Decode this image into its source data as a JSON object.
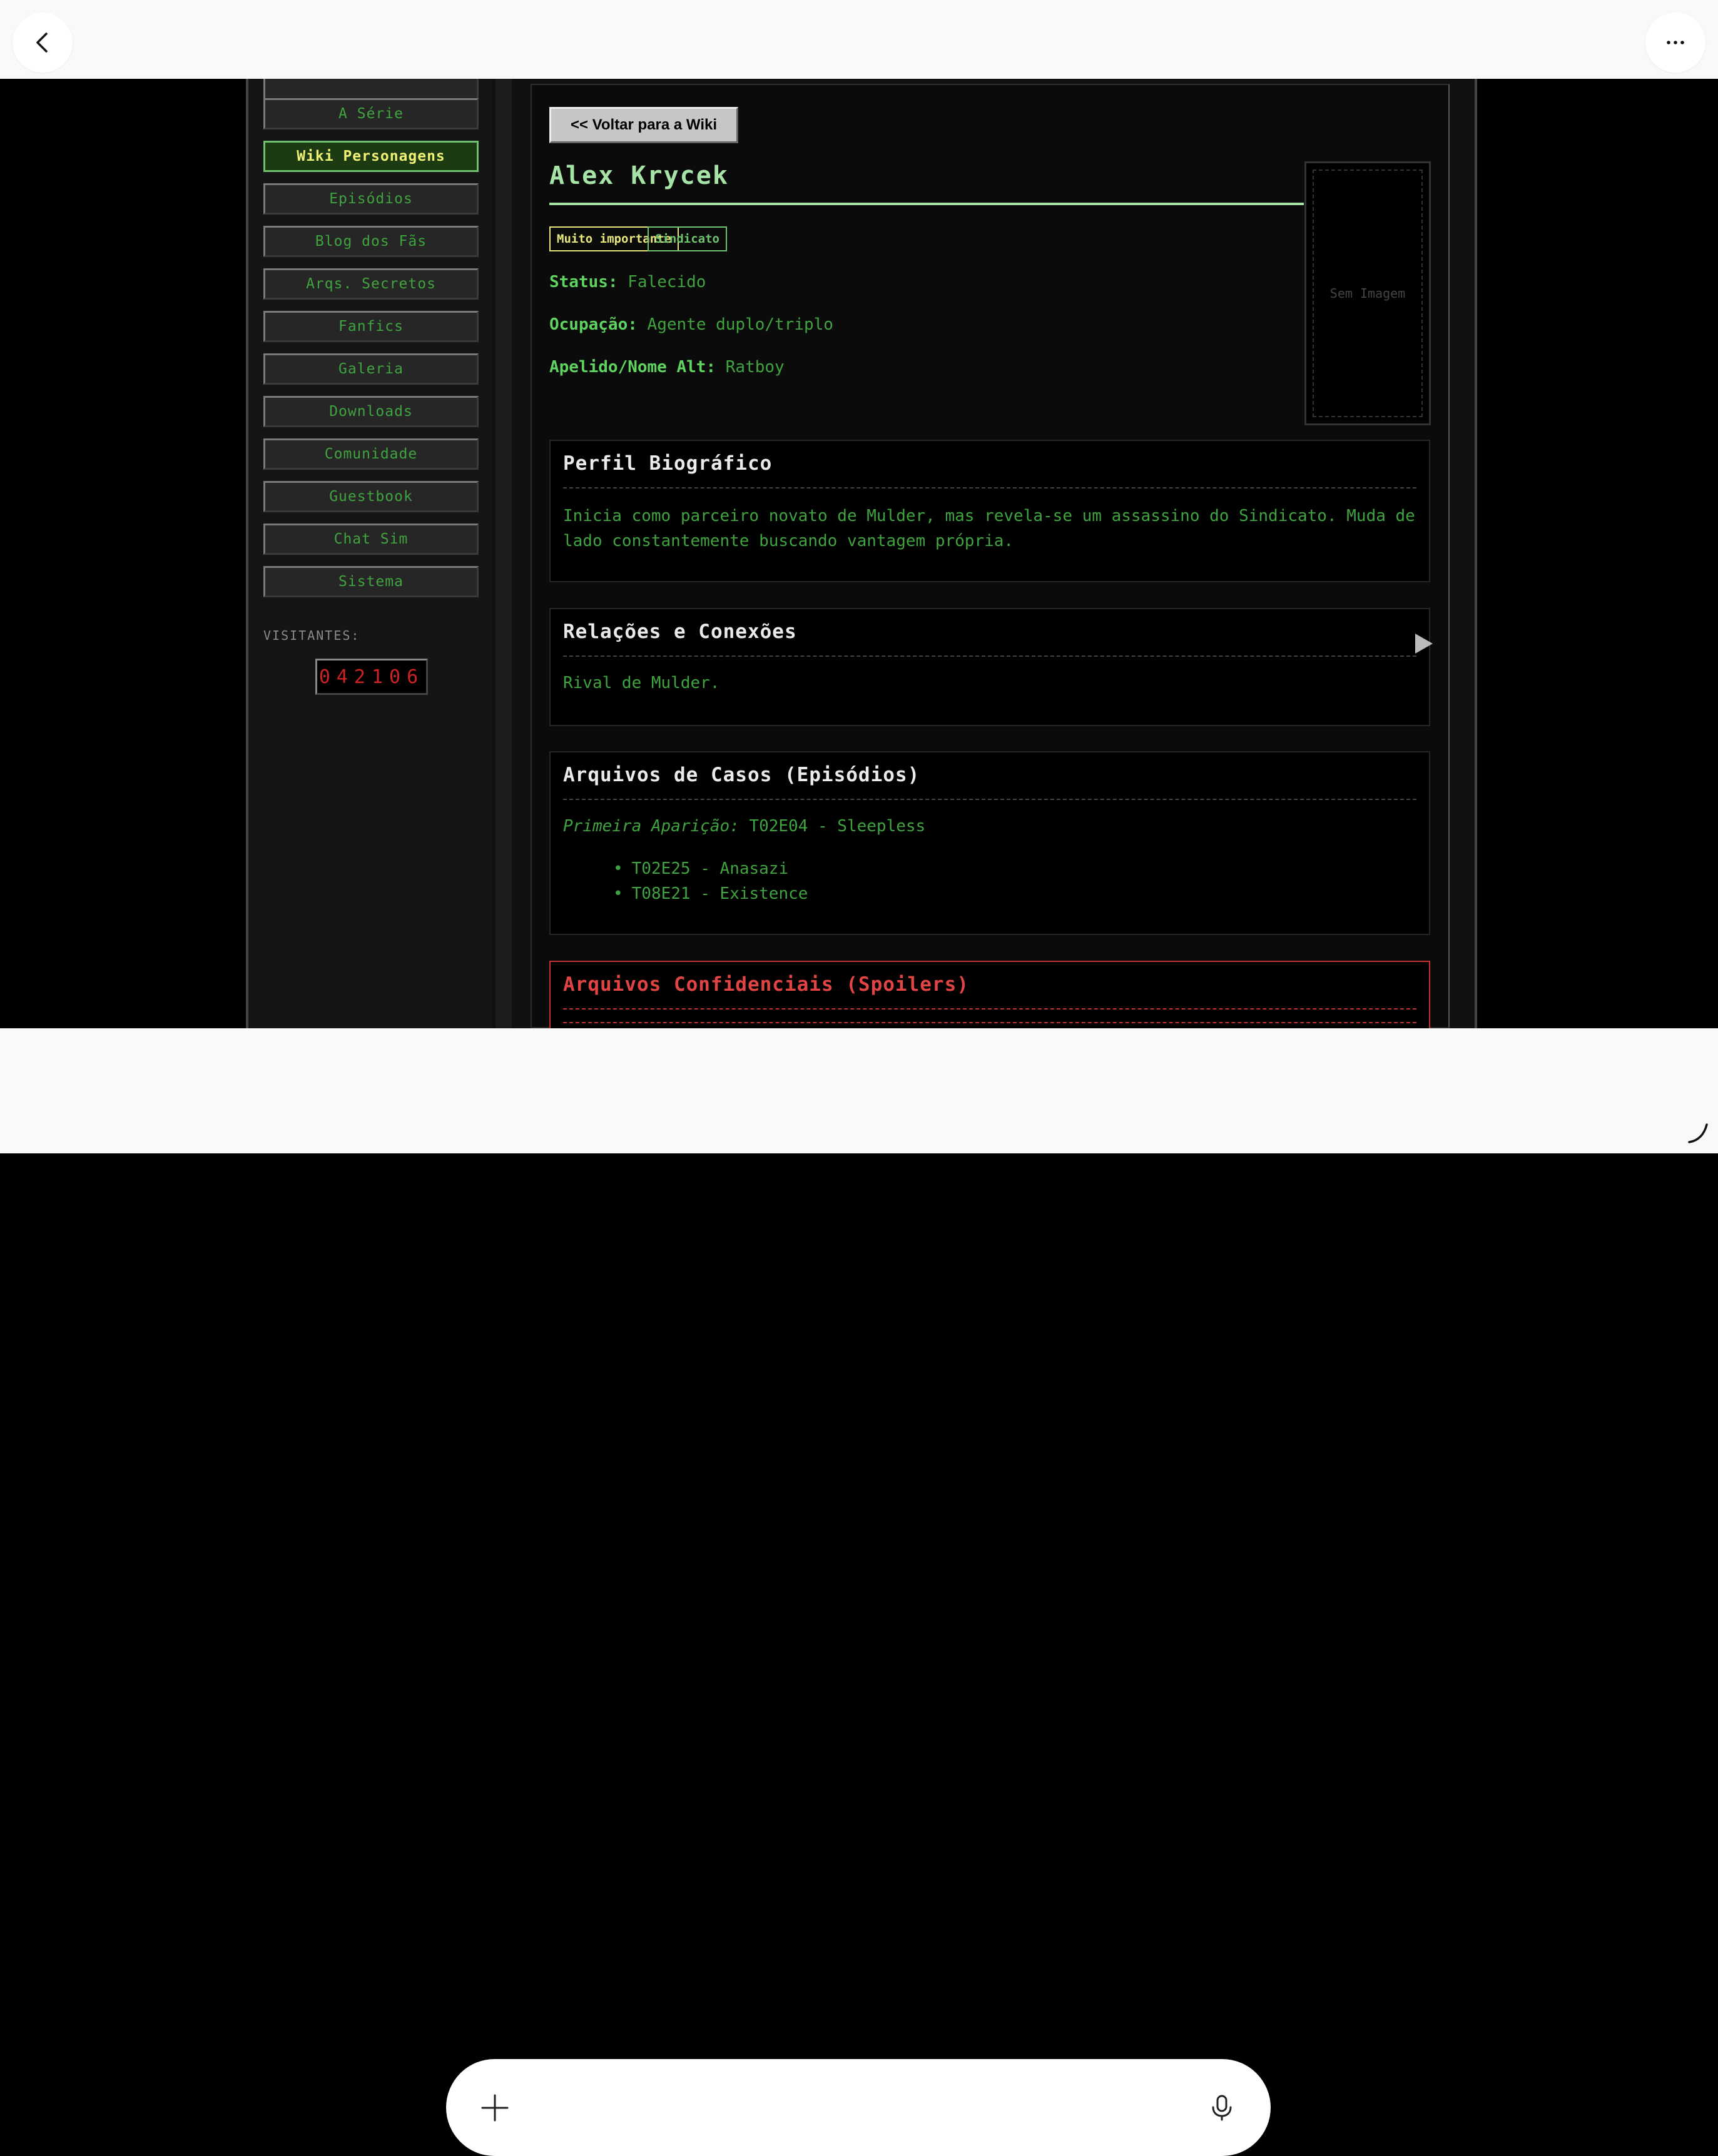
{
  "nav": {
    "items": [
      {
        "label": "A Série"
      },
      {
        "label": "Wiki Personagens"
      },
      {
        "label": "Episódios"
      },
      {
        "label": "Blog dos Fãs"
      },
      {
        "label": "Arqs. Secretos"
      },
      {
        "label": "Fanfics"
      },
      {
        "label": "Galeria"
      },
      {
        "label": "Downloads"
      },
      {
        "label": "Comunidade"
      },
      {
        "label": "Guestbook"
      },
      {
        "label": "Chat Sim"
      },
      {
        "label": "Sistema"
      }
    ],
    "active_index": 1,
    "visitors_label": "VISITANTES:",
    "visitors_count": "042106"
  },
  "character": {
    "back_label": "<< Voltar para a Wiki",
    "name": "Alex Krycek",
    "tags": [
      "Muito importante",
      "Sindicato"
    ],
    "fields": [
      {
        "label": "Status:",
        "value": "Falecido"
      },
      {
        "label": "Ocupação:",
        "value": "Agente duplo/triplo"
      },
      {
        "label": "Apelido/Nome Alt:",
        "value": "Ratboy"
      }
    ],
    "no_image_text": "Sem Imagem"
  },
  "sections": {
    "bio": {
      "title": "Perfil Biográfico",
      "text": "Inicia como parceiro novato de Mulder, mas revela-se um assassino do Sindicato. Muda de lado constantemente buscando vantagem própria."
    },
    "relations": {
      "title": "Relações e Conexões",
      "text": "Rival de Mulder."
    },
    "cases": {
      "title": "Arquivos de Casos (Episódios)",
      "first_label": "Primeira Aparição:",
      "first_value": "T02E04 - Sleepless",
      "episodes": [
        "T02E25 - Anasazi",
        "T08E21 - Existence"
      ]
    },
    "spoilers": {
      "title": "Arquivos Confidenciais (Spoilers)"
    }
  },
  "chrome": {
    "back_icon": "chevron-left-icon",
    "more_icon": "more-horizontal-icon",
    "plus_icon": "plus-icon",
    "mic_icon": "microphone-icon"
  },
  "colors": {
    "terminal_green": "#3fa33f",
    "highlight_yellow": "#f0f075",
    "spoiler_red": "#e24444",
    "counter_red": "#cc2222"
  }
}
